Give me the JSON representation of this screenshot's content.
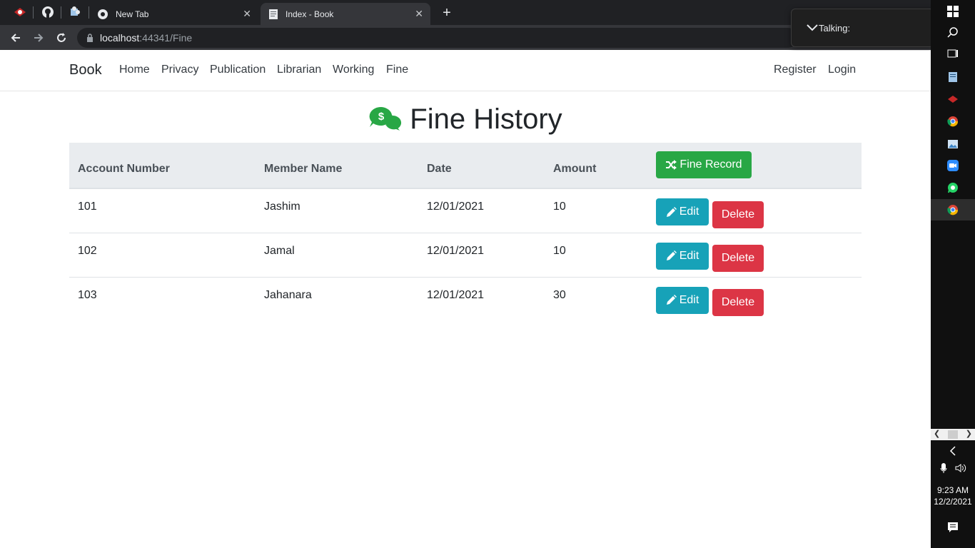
{
  "browser": {
    "tabs": [
      {
        "title": "New Tab",
        "active": false
      },
      {
        "title": "Index - Book",
        "active": true
      }
    ],
    "url_host": "localhost",
    "url_rest": ":44341/Fine",
    "popup_label": "Talking:"
  },
  "navbar": {
    "brand": "Book",
    "links": [
      "Home",
      "Privacy",
      "Publication",
      "Librarian",
      "Working",
      "Fine"
    ],
    "right_links": [
      "Register",
      "Login"
    ]
  },
  "page": {
    "title": "Fine History",
    "title_icon": "money-chat-icon",
    "title_icon_color": "#28a745"
  },
  "table": {
    "headers": [
      "Account Number",
      "Member Name",
      "Date",
      "Amount"
    ],
    "header_button": "Fine Record",
    "rows": [
      {
        "account": "101",
        "member": "Jashim",
        "date": "12/01/2021",
        "amount": "10"
      },
      {
        "account": "102",
        "member": "Jamal",
        "date": "12/01/2021",
        "amount": "10"
      },
      {
        "account": "103",
        "member": "Jahanara",
        "date": "12/01/2021",
        "amount": "30"
      }
    ],
    "edit_label": "Edit",
    "delete_label": "Delete"
  },
  "taskbar": {
    "time": "9:23 AM",
    "date": "12/2/2021"
  },
  "colors": {
    "success": "#28a745",
    "info": "#17a2b8",
    "danger": "#dc3545"
  }
}
